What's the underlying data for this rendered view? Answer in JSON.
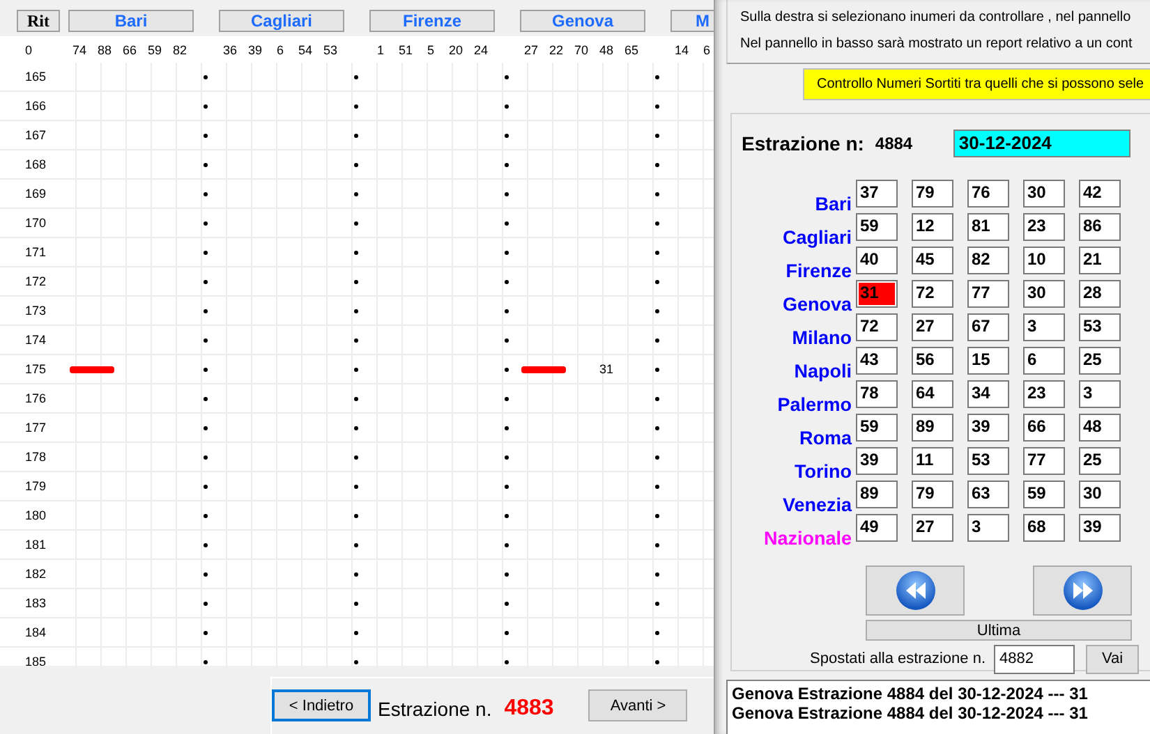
{
  "grid": {
    "corner": "Rit",
    "first_number": "0",
    "groups": [
      {
        "name": "Bari",
        "numbers": [
          "74",
          "88",
          "66",
          "59",
          "82"
        ]
      },
      {
        "name": "Cagliari",
        "numbers": [
          "36",
          "39",
          "6",
          "54",
          "53"
        ]
      },
      {
        "name": "Firenze",
        "numbers": [
          "1",
          "51",
          "5",
          "20",
          "24"
        ]
      },
      {
        "name": "Genova",
        "numbers": [
          "27",
          "22",
          "70",
          "48",
          "65"
        ]
      },
      {
        "name": "M",
        "numbers": [
          "14",
          "6"
        ]
      }
    ],
    "rows": [
      {
        "label": "165"
      },
      {
        "label": "166"
      },
      {
        "label": "167"
      },
      {
        "label": "168"
      },
      {
        "label": "169"
      },
      {
        "label": "170"
      },
      {
        "label": "171"
      },
      {
        "label": "172"
      },
      {
        "label": "173"
      },
      {
        "label": "174"
      },
      {
        "label": "175",
        "cells": [
          {
            "bar": true
          },
          {},
          {},
          {
            "bar": true,
            "text": "31"
          },
          {}
        ]
      },
      {
        "label": "176"
      },
      {
        "label": "177"
      },
      {
        "label": "178"
      },
      {
        "label": "179"
      },
      {
        "label": "180"
      },
      {
        "label": "181"
      },
      {
        "label": "182"
      },
      {
        "label": "183"
      },
      {
        "label": "184"
      },
      {
        "label": "185"
      }
    ]
  },
  "bottom_nav": {
    "back_button": "< Indietro",
    "label": "Estrazione n.",
    "number": "4883",
    "forward_button": "Avanti >"
  },
  "instructions": [
    "Sulla destra si selezionano inumeri da controllare , nel pannello",
    "Nel pannello in basso sarà mostrato un report relativo a un cont"
  ],
  "check_button": "Controllo Numeri Sortiti tra quelli che si possono sele",
  "draw": {
    "label": "Estrazione n:",
    "number": "4884",
    "date": "30-12-2024",
    "wheels": [
      {
        "name": "Bari",
        "color": "#0000ff",
        "numbers": [
          {
            "value": "37",
            "hit": false
          },
          {
            "value": "79",
            "hit": false
          },
          {
            "value": "76",
            "hit": false
          },
          {
            "value": "30",
            "hit": false
          },
          {
            "value": "42",
            "hit": false
          }
        ]
      },
      {
        "name": "Cagliari",
        "color": "#0000ff",
        "numbers": [
          {
            "value": "59",
            "hit": false
          },
          {
            "value": "12",
            "hit": false
          },
          {
            "value": "81",
            "hit": false
          },
          {
            "value": "23",
            "hit": false
          },
          {
            "value": "86",
            "hit": false
          }
        ]
      },
      {
        "name": "Firenze",
        "color": "#0000ff",
        "numbers": [
          {
            "value": "40",
            "hit": false
          },
          {
            "value": "45",
            "hit": false
          },
          {
            "value": "82",
            "hit": false
          },
          {
            "value": "10",
            "hit": false
          },
          {
            "value": "21",
            "hit": false
          }
        ]
      },
      {
        "name": "Genova",
        "color": "#0000ff",
        "numbers": [
          {
            "value": "31",
            "hit": true
          },
          {
            "value": "72",
            "hit": false
          },
          {
            "value": "77",
            "hit": false
          },
          {
            "value": "30",
            "hit": false
          },
          {
            "value": "28",
            "hit": false
          }
        ]
      },
      {
        "name": "Milano",
        "color": "#0000ff",
        "numbers": [
          {
            "value": "72",
            "hit": false
          },
          {
            "value": "27",
            "hit": false
          },
          {
            "value": "67",
            "hit": false
          },
          {
            "value": "3",
            "hit": false
          },
          {
            "value": "53",
            "hit": false
          }
        ]
      },
      {
        "name": "Napoli",
        "color": "#0000ff",
        "numbers": [
          {
            "value": "43",
            "hit": false
          },
          {
            "value": "56",
            "hit": false
          },
          {
            "value": "15",
            "hit": false
          },
          {
            "value": "6",
            "hit": false
          },
          {
            "value": "25",
            "hit": false
          }
        ]
      },
      {
        "name": "Palermo",
        "color": "#0000ff",
        "numbers": [
          {
            "value": "78",
            "hit": false
          },
          {
            "value": "64",
            "hit": false
          },
          {
            "value": "34",
            "hit": false
          },
          {
            "value": "23",
            "hit": false
          },
          {
            "value": "3",
            "hit": false
          }
        ]
      },
      {
        "name": "Roma",
        "color": "#0000ff",
        "numbers": [
          {
            "value": "59",
            "hit": false
          },
          {
            "value": "89",
            "hit": false
          },
          {
            "value": "39",
            "hit": false
          },
          {
            "value": "66",
            "hit": false
          },
          {
            "value": "48",
            "hit": false
          }
        ]
      },
      {
        "name": "Torino",
        "color": "#0000ff",
        "numbers": [
          {
            "value": "39",
            "hit": false
          },
          {
            "value": "11",
            "hit": false
          },
          {
            "value": "53",
            "hit": false
          },
          {
            "value": "77",
            "hit": false
          },
          {
            "value": "25",
            "hit": false
          }
        ]
      },
      {
        "name": "Venezia",
        "color": "#0000ff",
        "numbers": [
          {
            "value": "89",
            "hit": false
          },
          {
            "value": "79",
            "hit": false
          },
          {
            "value": "63",
            "hit": false
          },
          {
            "value": "59",
            "hit": false
          },
          {
            "value": "30",
            "hit": false
          }
        ]
      },
      {
        "name": "Nazionale",
        "color": "#ff00ff",
        "numbers": [
          {
            "value": "49",
            "hit": false
          },
          {
            "value": "27",
            "hit": false
          },
          {
            "value": "3",
            "hit": false
          },
          {
            "value": "68",
            "hit": false
          },
          {
            "value": "39",
            "hit": false
          }
        ]
      }
    ]
  },
  "last_button": "Ultima",
  "jump": {
    "label": "Spostati alla estrazione n.",
    "value": "4882",
    "button": "Vai"
  },
  "report": [
    "Genova Estrazione 4884 del 30-12-2024 --- 31",
    "Genova Estrazione 4884 del 30-12-2024 --- 31"
  ]
}
